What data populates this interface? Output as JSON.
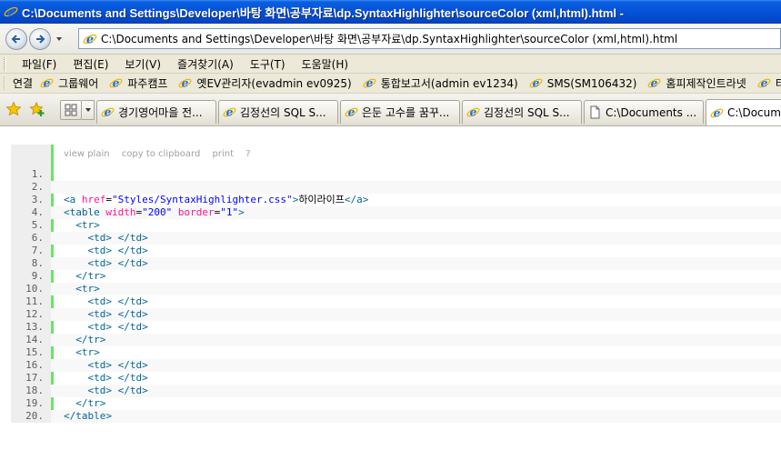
{
  "window": {
    "title": "C:\\Documents and Settings\\Developer\\바탕 화면\\공부자료\\dp.SyntaxHighlighter\\sourceColor (xml,html).html - "
  },
  "address_bar": {
    "value": "C:\\Documents and Settings\\Developer\\바탕 화면\\공부자료\\dp.SyntaxHighlighter\\sourceColor (xml,html).html"
  },
  "menu": {
    "items": [
      "파일(F)",
      "편집(E)",
      "보기(V)",
      "즐겨찾기(A)",
      "도구(T)",
      "도움말(H)"
    ]
  },
  "links_bar": {
    "label": "연결",
    "items": [
      "그룹웨어",
      "파주캠프",
      "옛EV관리자(evadmin ev0925)",
      "통합보고서(admin ev1234)",
      "SMS(SM106432)",
      "홈피제작인트라넷",
      "티켓"
    ]
  },
  "tabs": {
    "items": [
      {
        "label": "경기영어마을 전..."
      },
      {
        "label": "김정선의 SQL S..."
      },
      {
        "label": "은둔 고수를 꿈꾸..."
      },
      {
        "label": "김정선의 SQL S..."
      },
      {
        "label": "C:\\Documents ..."
      },
      {
        "label": "C:\\Documents"
      }
    ]
  },
  "code_toolbar": {
    "view_plain": "view plain",
    "copy": "copy to clipboard",
    "print": "print",
    "help": "?"
  },
  "code_lines": [
    {
      "num": "1.",
      "tokens": []
    },
    {
      "num": "2.",
      "tokens": []
    },
    {
      "num": "3.",
      "tokens": [
        {
          "t": "tag",
          "v": "<a "
        },
        {
          "t": "attr",
          "v": "href"
        },
        {
          "t": "text",
          "v": "="
        },
        {
          "t": "val",
          "v": "\"Styles/SyntaxHighlighter.css\""
        },
        {
          "t": "tag",
          "v": ">"
        },
        {
          "t": "text",
          "v": "하이라이프"
        },
        {
          "t": "tag",
          "v": "</a>"
        }
      ]
    },
    {
      "num": "4.",
      "tokens": [
        {
          "t": "tag",
          "v": "<table "
        },
        {
          "t": "attr",
          "v": "width"
        },
        {
          "t": "text",
          "v": "="
        },
        {
          "t": "val",
          "v": "\"200\""
        },
        {
          "t": "text",
          "v": " "
        },
        {
          "t": "attr",
          "v": "border"
        },
        {
          "t": "text",
          "v": "="
        },
        {
          "t": "val",
          "v": "\"1\""
        },
        {
          "t": "tag",
          "v": ">"
        }
      ]
    },
    {
      "num": "5.",
      "tokens": [
        {
          "t": "text",
          "v": "  "
        },
        {
          "t": "tag",
          "v": "<tr>"
        }
      ]
    },
    {
      "num": "6.",
      "tokens": [
        {
          "t": "text",
          "v": "    "
        },
        {
          "t": "tag",
          "v": "<td>"
        },
        {
          "t": "text",
          "v": " "
        },
        {
          "t": "tag",
          "v": "</td>"
        }
      ]
    },
    {
      "num": "7.",
      "tokens": [
        {
          "t": "text",
          "v": "    "
        },
        {
          "t": "tag",
          "v": "<td>"
        },
        {
          "t": "text",
          "v": " "
        },
        {
          "t": "tag",
          "v": "</td>"
        }
      ]
    },
    {
      "num": "8.",
      "tokens": [
        {
          "t": "text",
          "v": "    "
        },
        {
          "t": "tag",
          "v": "<td>"
        },
        {
          "t": "text",
          "v": " "
        },
        {
          "t": "tag",
          "v": "</td>"
        }
      ]
    },
    {
      "num": "9.",
      "tokens": [
        {
          "t": "text",
          "v": "  "
        },
        {
          "t": "tag",
          "v": "</tr>"
        }
      ]
    },
    {
      "num": "10.",
      "tokens": [
        {
          "t": "text",
          "v": "  "
        },
        {
          "t": "tag",
          "v": "<tr>"
        }
      ]
    },
    {
      "num": "11.",
      "tokens": [
        {
          "t": "text",
          "v": "    "
        },
        {
          "t": "tag",
          "v": "<td>"
        },
        {
          "t": "text",
          "v": " "
        },
        {
          "t": "tag",
          "v": "</td>"
        }
      ]
    },
    {
      "num": "12.",
      "tokens": [
        {
          "t": "text",
          "v": "    "
        },
        {
          "t": "tag",
          "v": "<td>"
        },
        {
          "t": "text",
          "v": " "
        },
        {
          "t": "tag",
          "v": "</td>"
        }
      ]
    },
    {
      "num": "13.",
      "tokens": [
        {
          "t": "text",
          "v": "    "
        },
        {
          "t": "tag",
          "v": "<td>"
        },
        {
          "t": "text",
          "v": " "
        },
        {
          "t": "tag",
          "v": "</td>"
        }
      ]
    },
    {
      "num": "14.",
      "tokens": [
        {
          "t": "text",
          "v": "  "
        },
        {
          "t": "tag",
          "v": "</tr>"
        }
      ]
    },
    {
      "num": "15.",
      "tokens": [
        {
          "t": "text",
          "v": "  "
        },
        {
          "t": "tag",
          "v": "<tr>"
        }
      ]
    },
    {
      "num": "16.",
      "tokens": [
        {
          "t": "text",
          "v": "    "
        },
        {
          "t": "tag",
          "v": "<td>"
        },
        {
          "t": "text",
          "v": " "
        },
        {
          "t": "tag",
          "v": "</td>"
        }
      ]
    },
    {
      "num": "17.",
      "tokens": [
        {
          "t": "text",
          "v": "    "
        },
        {
          "t": "tag",
          "v": "<td>"
        },
        {
          "t": "text",
          "v": " "
        },
        {
          "t": "tag",
          "v": "</td>"
        }
      ]
    },
    {
      "num": "18.",
      "tokens": [
        {
          "t": "text",
          "v": "    "
        },
        {
          "t": "tag",
          "v": "<td>"
        },
        {
          "t": "text",
          "v": " "
        },
        {
          "t": "tag",
          "v": "</td>"
        }
      ]
    },
    {
      "num": "19.",
      "tokens": [
        {
          "t": "text",
          "v": "  "
        },
        {
          "t": "tag",
          "v": "</tr>"
        }
      ]
    },
    {
      "num": "20.",
      "tokens": [
        {
          "t": "tag",
          "v": "</table>"
        }
      ]
    }
  ],
  "colors": {
    "titlebar": "#0552d6",
    "gutter_accent": "#6ce26c",
    "tag": "#006699",
    "attr": "#ff1493",
    "value": "#0000ff"
  }
}
